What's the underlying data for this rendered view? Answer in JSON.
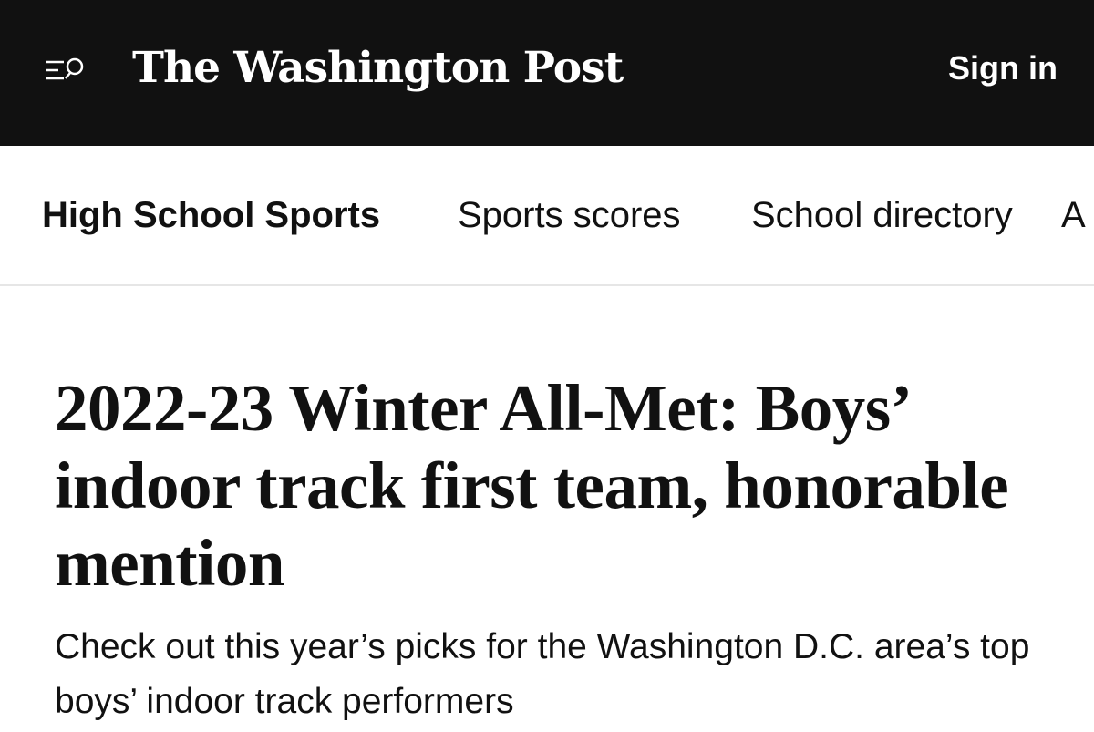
{
  "header": {
    "brand": "The Washington Post",
    "sign_in_label": "Sign in",
    "menu_icon": "menu-search-icon"
  },
  "subnav": {
    "section_label": "High School Sports",
    "items": [
      {
        "label": "Sports scores"
      },
      {
        "label": "School directory"
      },
      {
        "label": "A"
      }
    ]
  },
  "article": {
    "headline": "2022-23 Winter All-Met: Boys’ indoor track first team, honorable mention",
    "dek": "Check out this year’s picks for the Washington D.C. area’s top boys’ indoor track performers"
  }
}
